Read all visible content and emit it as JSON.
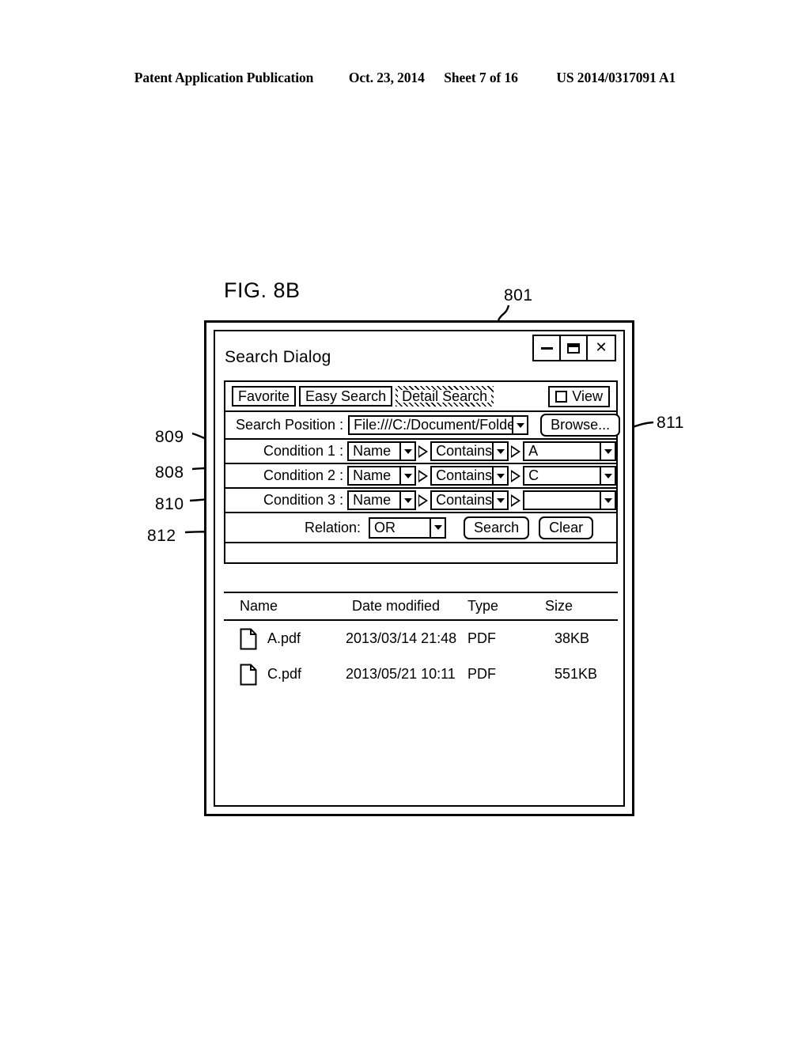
{
  "page_header": {
    "publication": "Patent Application Publication",
    "date": "Oct. 23, 2014",
    "sheet": "Sheet 7 of 16",
    "number": "US 2014/0317091 A1"
  },
  "figure": {
    "label": "FIG. 8B"
  },
  "reference_numerals": {
    "dialog": "801",
    "condition1_value": "811",
    "search_position": "809",
    "condition_attribute": "808",
    "condition_operator": "810",
    "relation": "812"
  },
  "dialog": {
    "title": "Search Dialog",
    "window_buttons": {
      "minimize": "minimize-icon",
      "maximize": "maximize-icon",
      "close": "close-icon"
    },
    "tabs": [
      {
        "label": "Favorite",
        "selected": false
      },
      {
        "label": "Easy Search",
        "selected": false
      },
      {
        "label": "Detail Search",
        "selected": true
      }
    ],
    "view_toggle": {
      "label": "View",
      "checked": false
    },
    "search_position": {
      "label": "Search Position :",
      "value": "File:///C:/Document/Folder",
      "browse_label": "Browse..."
    },
    "conditions": [
      {
        "label": "Condition 1 :",
        "attribute": "Name",
        "operator": "Contains",
        "value": "A"
      },
      {
        "label": "Condition 2 :",
        "attribute": "Name",
        "operator": "Contains",
        "value": "C"
      },
      {
        "label": "Condition 3 :",
        "attribute": "Name",
        "operator": "Contains",
        "value": ""
      }
    ],
    "relation": {
      "label": "Relation:",
      "value": "OR"
    },
    "actions": {
      "search_label": "Search",
      "clear_label": "Clear"
    },
    "results": {
      "columns": [
        "Name",
        "Date modified",
        "Type",
        "Size"
      ],
      "rows": [
        {
          "name": "A.pdf",
          "date": "2013/03/14  21:48",
          "type": "PDF",
          "size": "38KB"
        },
        {
          "name": "C.pdf",
          "date": "2013/05/21  10:11",
          "type": "PDF",
          "size": "551KB"
        }
      ]
    }
  },
  "colors": {
    "ink": "#000000",
    "paper": "#ffffff"
  }
}
